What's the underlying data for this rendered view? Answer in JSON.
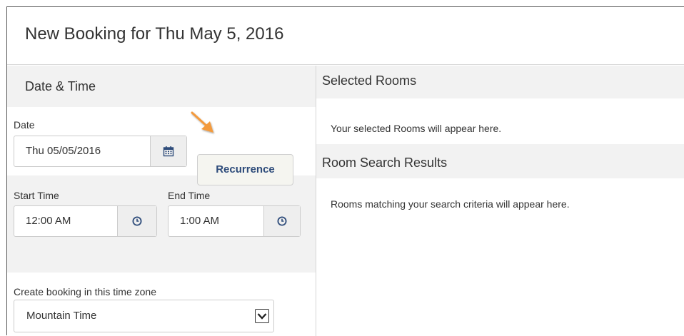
{
  "header": {
    "title": "New Booking for Thu May 5, 2016"
  },
  "date_time": {
    "section_title": "Date & Time",
    "date_label": "Date",
    "date_value": "Thu 05/05/2016",
    "recurrence_label": "Recurrence",
    "start_label": "Start Time",
    "start_value": "12:00 AM",
    "end_label": "End Time",
    "end_value": "1:00 AM",
    "timezone_label": "Create booking in this time zone",
    "timezone_value": "Mountain Time"
  },
  "selected_rooms": {
    "title": "Selected Rooms",
    "empty_text": "Your selected Rooms will appear here."
  },
  "search_results": {
    "title": "Room Search Results",
    "empty_text": "Rooms matching your search criteria will appear here."
  },
  "icons": {
    "date": "calendar-icon",
    "start": "clock-icon",
    "end": "clock-icon",
    "dropdown": "chevron-down-icon",
    "annotation": "arrow-pointer-icon"
  },
  "colors": {
    "accent_text": "#2d4b7a",
    "section_bg": "#f2f2f2",
    "annotation_arrow": "#f39a3c"
  }
}
